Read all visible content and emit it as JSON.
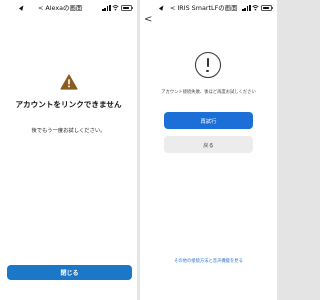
{
  "left_screen": {
    "status": {
      "time": "",
      "back_label": "< Alexaの画面"
    },
    "title": "アカウントをリンクできません",
    "subtitle": "後でもう一度お試しください。",
    "close_button": "閉じる",
    "warning_color": "#8a5a1f",
    "icons": {
      "warning": "warning-icon"
    }
  },
  "right_screen": {
    "status": {
      "time": "",
      "back_label": "< IRIS SmartLFの画面"
    },
    "nav_back": "<",
    "message": "アカウント接続失敗、後ほど再度お試しください",
    "retry_button": "再試行",
    "back_button": "戻る",
    "other_methods_link": "その他の接続方法と音声機能を見る",
    "icons": {
      "info": "info-icon"
    }
  },
  "colors": {
    "primary_button": "#1b78c9",
    "retry_button": "#1d6fd8",
    "secondary_button": "#ececec",
    "link": "#2a73c9"
  },
  "battery_level": 0.7
}
